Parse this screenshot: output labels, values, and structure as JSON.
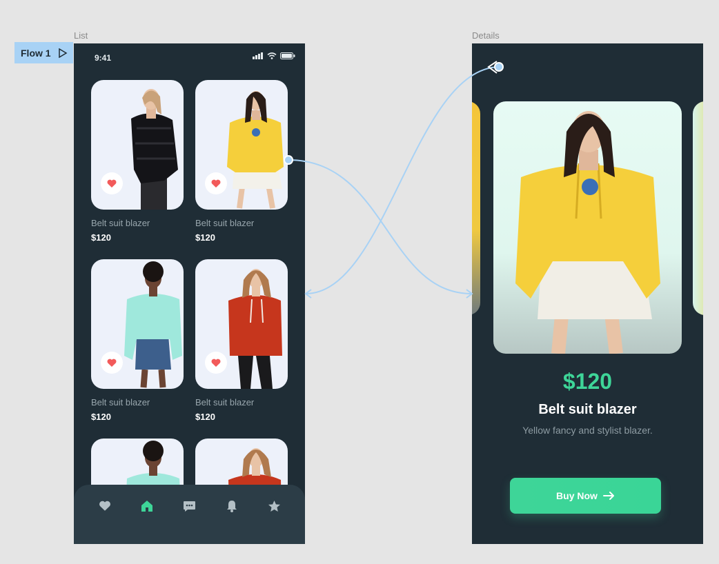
{
  "canvas": {
    "list_label": "List",
    "details_label": "Details",
    "flow_label": "Flow 1"
  },
  "list": {
    "status_time": "9:41",
    "cards": [
      {
        "name": "Belt suit blazer",
        "price": "$120",
        "outfit": "black-puffer"
      },
      {
        "name": "Belt suit blazer",
        "price": "$120",
        "outfit": "yellow-hoodie"
      },
      {
        "name": "Belt suit blazer",
        "price": "$120",
        "outfit": "mint-hoodie"
      },
      {
        "name": "Belt suit blazer",
        "price": "$120",
        "outfit": "red-hoodie"
      },
      {
        "name": "",
        "price": "",
        "outfit": "mint-hoodie"
      },
      {
        "name": "",
        "price": "",
        "outfit": "red-hoodie"
      }
    ],
    "nav": [
      "heart-icon",
      "home-icon",
      "chat-icon",
      "bell-icon",
      "star-icon"
    ],
    "active_nav": "home-icon"
  },
  "details": {
    "price": "$120",
    "name": "Belt suit blazer",
    "description": "Yellow fancy and stylist blazer.",
    "buy_label": "Buy Now"
  },
  "colors": {
    "frame_bg": "#1f2d36",
    "accent": "#3ed598",
    "card_bg": "#edf1fa",
    "heart": "#f25a5a",
    "connector": "#a8d2f5"
  }
}
